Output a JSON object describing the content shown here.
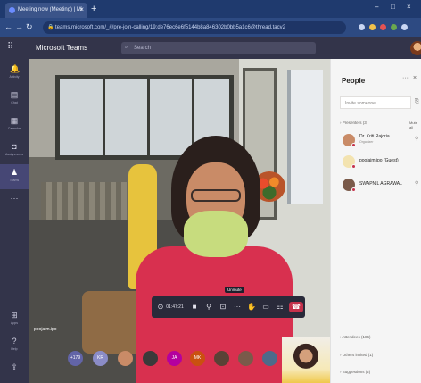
{
  "browser": {
    "tab_title": "Meeting now (Meeting) | Mi",
    "url": "teams.microsoft.com/_#/pre-join-calling/19:de76ec6e6f5144b8a846302b0bb5a1c6@thread.tacv2"
  },
  "teams": {
    "app_title": "Microsoft Teams",
    "search_placeholder": "Search"
  },
  "rail": {
    "items": [
      {
        "label": "Activity",
        "icon": "bell-icon"
      },
      {
        "label": "Chat",
        "icon": "chat-icon"
      },
      {
        "label": "Calendar",
        "icon": "calendar-icon"
      },
      {
        "label": "Assignments",
        "icon": "assignments-icon"
      },
      {
        "label": "Teams",
        "icon": "teams-icon"
      }
    ],
    "bottom": [
      {
        "label": "Apps",
        "icon": "apps-icon"
      },
      {
        "label": "Help",
        "icon": "help-icon"
      }
    ]
  },
  "call": {
    "timer": "01:47:21",
    "tooltip": "Unmute",
    "presenter_name": "poojaim.ipo",
    "strip": [
      {
        "text": "+179",
        "color": "#6264a7"
      },
      {
        "text": "KR",
        "color": "#8b8cc7"
      },
      {
        "text": "",
        "color": "#c98b67"
      },
      {
        "text": "",
        "color": "#3a3a3a"
      },
      {
        "text": "JA",
        "color": "#b4009e"
      },
      {
        "text": "MK",
        "color": "#ca5010"
      },
      {
        "text": "",
        "color": "#5a4236"
      },
      {
        "text": "",
        "color": "#7a5a4a"
      },
      {
        "text": "",
        "color": "#4e6a8a"
      }
    ]
  },
  "people": {
    "title": "People",
    "invite_placeholder": "Invite someone",
    "presenters_label": "Presenters (3)",
    "mute_all": "Mute all",
    "participants": [
      {
        "name": "Dr. Kriti Rajoria",
        "role": "Organizer",
        "avatar_color": "#c98b67"
      },
      {
        "name": "poojaim.ipo (Guest)",
        "role": "",
        "avatar_color": "#f3e3b0"
      },
      {
        "name": "SWAPNIL AGRAWAL",
        "role": "",
        "avatar_color": "#7a5a4a"
      }
    ],
    "attendees_label": "Attendees (186)",
    "others_invited_label": "Others invited (1)",
    "suggestions_label": "Suggestions (2)"
  }
}
